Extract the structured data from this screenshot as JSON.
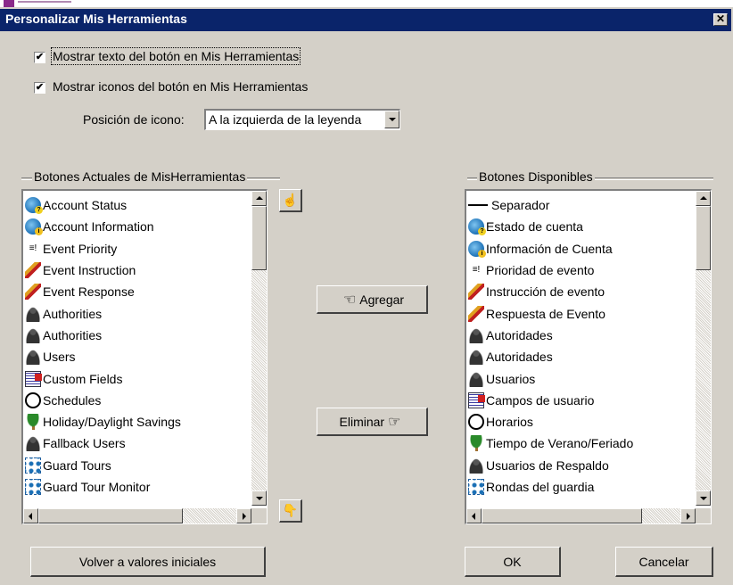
{
  "window": {
    "title": "Personalizar Mis Herramientas",
    "close_glyph": "✕"
  },
  "options": {
    "show_text_label": "Mostrar texto del botón en Mis Herramientas",
    "show_text_checked": true,
    "show_icons_label": "Mostrar iconos del botón en Mis Herramientas",
    "show_icons_checked": true,
    "icon_position_label": "Posición de icono:",
    "icon_position_value": "A la izquierda de la leyenda"
  },
  "current": {
    "group_label": "Botones Actuales de MisHerramientas",
    "items": [
      {
        "label": "Account Status",
        "icon": "account-status-icon"
      },
      {
        "label": "Account Information",
        "icon": "account-information-icon"
      },
      {
        "label": "Event Priority",
        "icon": "event-priority-icon"
      },
      {
        "label": "Event Instruction",
        "icon": "event-instruction-icon"
      },
      {
        "label": "Event Response",
        "icon": "event-response-icon"
      },
      {
        "label": "Authorities",
        "icon": "authorities-icon"
      },
      {
        "label": "Authorities",
        "icon": "authorities-icon"
      },
      {
        "label": "Users",
        "icon": "users-icon"
      },
      {
        "label": "Custom Fields",
        "icon": "custom-fields-icon"
      },
      {
        "label": "Schedules",
        "icon": "schedules-icon"
      },
      {
        "label": "Holiday/Daylight Savings",
        "icon": "holiday-icon"
      },
      {
        "label": "Fallback Users",
        "icon": "fallback-users-icon"
      },
      {
        "label": "Guard Tours",
        "icon": "guard-tours-icon"
      },
      {
        "label": "Guard Tour Monitor",
        "icon": "guard-tour-monitor-icon"
      }
    ]
  },
  "available": {
    "group_label": "Botones Disponibles",
    "items": [
      {
        "label": "Separador",
        "icon": "separator-icon"
      },
      {
        "label": "Estado de cuenta",
        "icon": "account-status-icon"
      },
      {
        "label": "Información de Cuenta",
        "icon": "account-information-icon"
      },
      {
        "label": "Prioridad de evento",
        "icon": "event-priority-icon"
      },
      {
        "label": "Instrucción de evento",
        "icon": "event-instruction-icon"
      },
      {
        "label": "Respuesta de Evento",
        "icon": "event-response-icon"
      },
      {
        "label": "Autoridades",
        "icon": "authorities-icon"
      },
      {
        "label": "Autoridades",
        "icon": "authorities-icon"
      },
      {
        "label": "Usuarios",
        "icon": "users-icon"
      },
      {
        "label": "Campos de usuario",
        "icon": "custom-fields-icon"
      },
      {
        "label": "Horarios",
        "icon": "schedules-icon"
      },
      {
        "label": "Tiempo de Verano/Feriado",
        "icon": "holiday-icon"
      },
      {
        "label": "Usuarios de Respaldo",
        "icon": "fallback-users-icon"
      },
      {
        "label": "Rondas del guardia",
        "icon": "guard-tours-icon"
      }
    ]
  },
  "buttons": {
    "add_label": "Agregar",
    "remove_label": "Eliminar",
    "reset_label": "Volver a valores iniciales",
    "ok_label": "OK",
    "cancel_label": "Cancelar",
    "move_up_icon": "hand-up-icon",
    "move_down_icon": "hand-down-icon"
  }
}
